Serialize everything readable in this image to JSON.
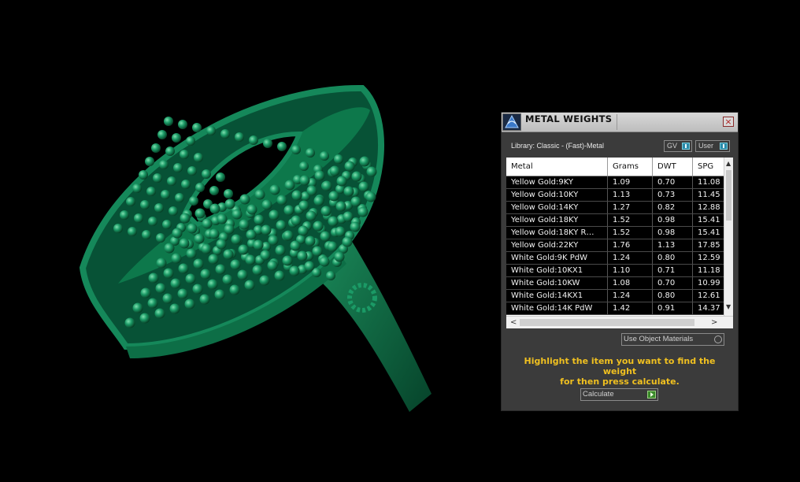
{
  "panel": {
    "title": "METAL WEIGHTS",
    "close_icon": "close-icon",
    "library_label": "Library: Classic - (Fast)-Metal",
    "toggles": [
      {
        "label": "GV"
      },
      {
        "label": "User"
      }
    ],
    "table": {
      "columns": [
        "Metal",
        "Grams",
        "DWT",
        "SPG"
      ],
      "rows": [
        {
          "metal": "Yellow Gold:9KY",
          "grams": "1.09",
          "dwt": "0.70",
          "spg": "11.08"
        },
        {
          "metal": "Yellow Gold:10KY",
          "grams": "1.13",
          "dwt": "0.73",
          "spg": "11.45"
        },
        {
          "metal": "Yellow Gold:14KY",
          "grams": "1.27",
          "dwt": "0.82",
          "spg": "12.88"
        },
        {
          "metal": "Yellow Gold:18KY",
          "grams": "1.52",
          "dwt": "0.98",
          "spg": "15.41"
        },
        {
          "metal": "Yellow Gold:18KY R…",
          "grams": "1.52",
          "dwt": "0.98",
          "spg": "15.41"
        },
        {
          "metal": "Yellow Gold:22KY",
          "grams": "1.76",
          "dwt": "1.13",
          "spg": "17.85"
        },
        {
          "metal": "White Gold:9K PdW",
          "grams": "1.24",
          "dwt": "0.80",
          "spg": "12.59"
        },
        {
          "metal": "White Gold:10KX1",
          "grams": "1.10",
          "dwt": "0.71",
          "spg": "11.18"
        },
        {
          "metal": "White Gold:10KW",
          "grams": "1.08",
          "dwt": "0.70",
          "spg": "10.99"
        },
        {
          "metal": "White Gold:14KX1",
          "grams": "1.24",
          "dwt": "0.80",
          "spg": "12.61"
        },
        {
          "metal": "White Gold:14K PdW",
          "grams": "1.42",
          "dwt": "0.91",
          "spg": "14.37"
        }
      ]
    },
    "use_materials_label": "Use Object Materials",
    "hint_line1": "Highlight the item you want to find the weight",
    "hint_line2": "for then press calculate.",
    "calculate_label": "Calculate",
    "colors": {
      "accent_yellow": "#f0c020",
      "ring_green": "#0f7a4c"
    }
  }
}
